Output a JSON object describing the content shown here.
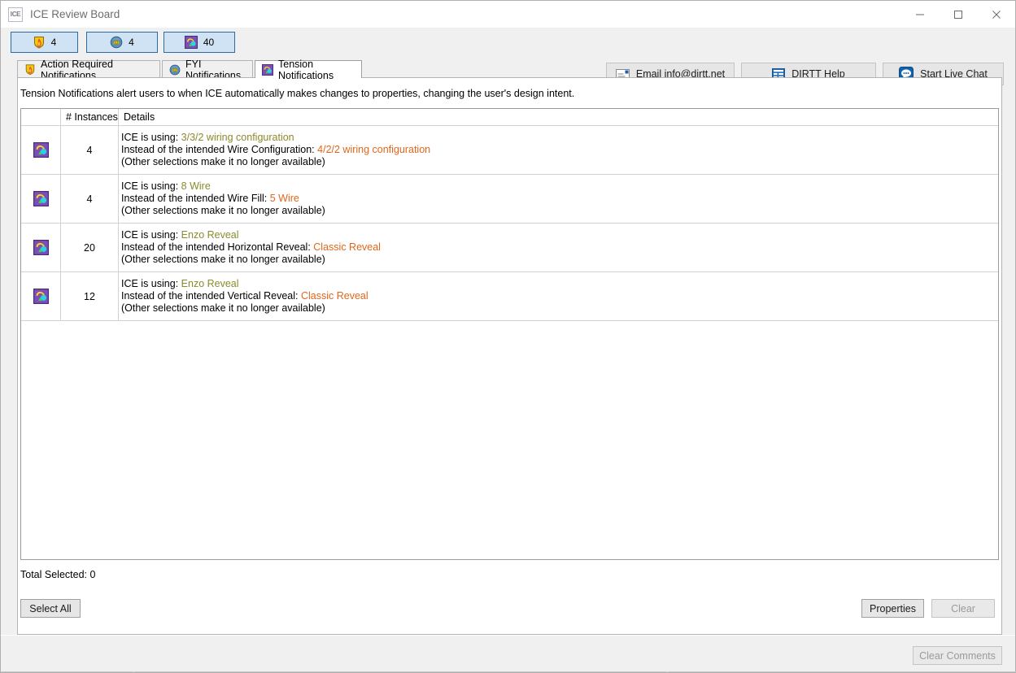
{
  "window": {
    "title": "ICE Review Board",
    "app_icon_label": "ICE",
    "controls": {
      "minimize": "minimize-icon",
      "maximize": "maximize-icon",
      "close": "close-icon"
    }
  },
  "toolbar": {
    "counters": [
      {
        "icon": "action-required-shield-icon",
        "count": "4"
      },
      {
        "icon": "fyi-globe-icon",
        "count": "4"
      },
      {
        "icon": "tension-icon",
        "count": "40"
      }
    ],
    "actions": [
      {
        "icon": "email-icon",
        "label": "Email info@dirtt.net"
      },
      {
        "icon": "help-table-icon",
        "label": "DIRTT Help"
      },
      {
        "icon": "live-chat-icon",
        "label": "Start Live Chat"
      }
    ]
  },
  "tabs": [
    {
      "icon": "action-required-shield-icon",
      "label": "Action Required Notifications",
      "active": false
    },
    {
      "icon": "fyi-globe-icon",
      "label": "FYI Notifications",
      "active": false
    },
    {
      "icon": "tension-icon",
      "label": "Tension Notifications",
      "active": true
    }
  ],
  "main": {
    "intro": "Tension Notifications alert users to when ICE automatically makes changes to properties, changing the user's design intent.",
    "grid": {
      "columns": [
        "",
        "# Instances",
        "Details"
      ],
      "rows": [
        {
          "icon": "tension-icon",
          "instances": "4",
          "line1_label": "ICE is using:",
          "line1_value": "3/3/2 wiring configuration",
          "line2_label": "Instead of the intended Wire Configuration:",
          "line2_value": "4/2/2 wiring configuration",
          "line3": "(Other selections make it no longer available)"
        },
        {
          "icon": "tension-icon",
          "instances": "4",
          "line1_label": "ICE is using:",
          "line1_value": "8 Wire",
          "line2_label": "Instead of the intended Wire Fill:",
          "line2_value": "5 Wire",
          "line3": "(Other selections make it no longer available)"
        },
        {
          "icon": "tension-icon",
          "instances": "20",
          "line1_label": "ICE is using:",
          "line1_value": "Enzo Reveal",
          "line2_label": "Instead of the intended Horizontal Reveal:",
          "line2_value": "Classic Reveal",
          "line3": "(Other selections make it no longer available)"
        },
        {
          "icon": "tension-icon",
          "instances": "12",
          "line1_label": "ICE is using:",
          "line1_value": "Enzo Reveal",
          "line2_label": "Instead of the intended Vertical Reveal:",
          "line2_value": "Classic Reveal",
          "line3": "(Other selections make it no longer available)"
        }
      ]
    },
    "total_selected": "Total Selected: 0",
    "buttons": {
      "select_all": "Select All",
      "properties": "Properties",
      "clear": "Clear"
    }
  },
  "statusbar": {
    "clear_comments": "Clear Comments"
  },
  "colors": {
    "accent_blue": "#2a6ca8",
    "counter_bg": "#cfe3f5",
    "value_using": "#8a8a2b",
    "value_intended": "#e2661a",
    "window_bg": "#f0f0f0"
  }
}
